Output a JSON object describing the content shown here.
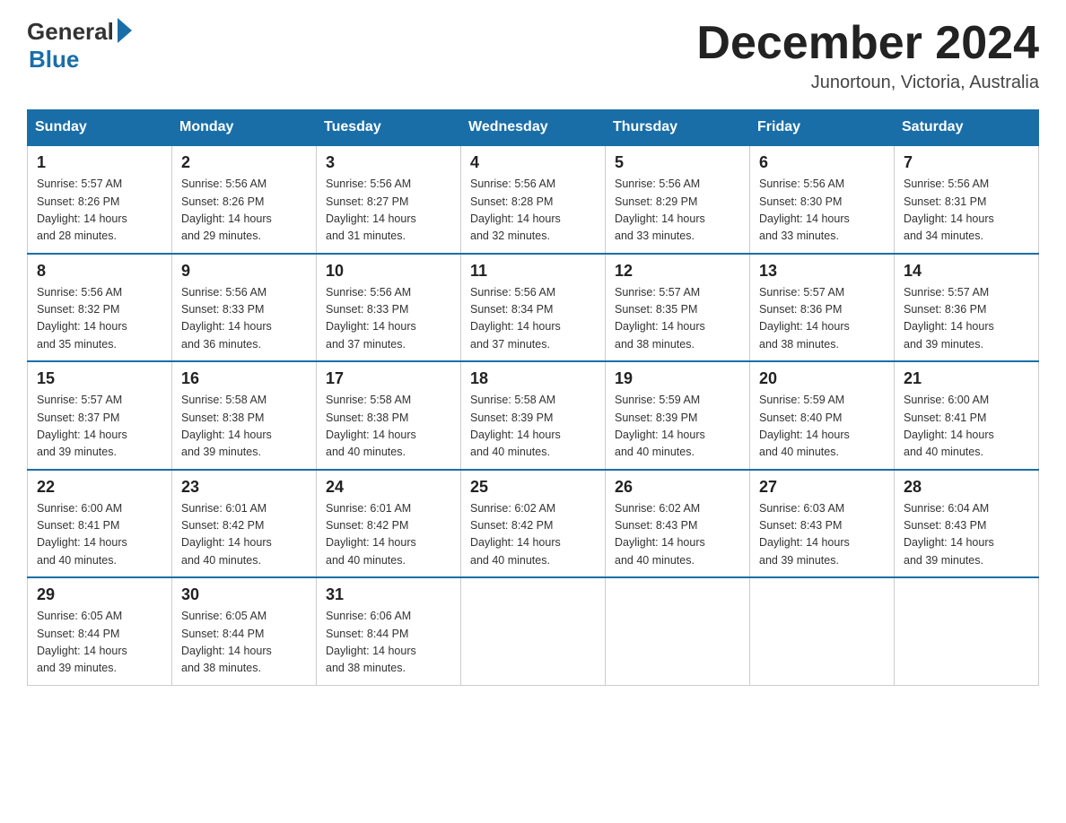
{
  "header": {
    "logo_general": "General",
    "logo_blue": "Blue",
    "month_title": "December 2024",
    "location": "Junortoun, Victoria, Australia"
  },
  "days_of_week": [
    "Sunday",
    "Monday",
    "Tuesday",
    "Wednesday",
    "Thursday",
    "Friday",
    "Saturday"
  ],
  "weeks": [
    [
      {
        "day": "1",
        "sunrise": "5:57 AM",
        "sunset": "8:26 PM",
        "daylight": "14 hours and 28 minutes."
      },
      {
        "day": "2",
        "sunrise": "5:56 AM",
        "sunset": "8:26 PM",
        "daylight": "14 hours and 29 minutes."
      },
      {
        "day": "3",
        "sunrise": "5:56 AM",
        "sunset": "8:27 PM",
        "daylight": "14 hours and 31 minutes."
      },
      {
        "day": "4",
        "sunrise": "5:56 AM",
        "sunset": "8:28 PM",
        "daylight": "14 hours and 32 minutes."
      },
      {
        "day": "5",
        "sunrise": "5:56 AM",
        "sunset": "8:29 PM",
        "daylight": "14 hours and 33 minutes."
      },
      {
        "day": "6",
        "sunrise": "5:56 AM",
        "sunset": "8:30 PM",
        "daylight": "14 hours and 33 minutes."
      },
      {
        "day": "7",
        "sunrise": "5:56 AM",
        "sunset": "8:31 PM",
        "daylight": "14 hours and 34 minutes."
      }
    ],
    [
      {
        "day": "8",
        "sunrise": "5:56 AM",
        "sunset": "8:32 PM",
        "daylight": "14 hours and 35 minutes."
      },
      {
        "day": "9",
        "sunrise": "5:56 AM",
        "sunset": "8:33 PM",
        "daylight": "14 hours and 36 minutes."
      },
      {
        "day": "10",
        "sunrise": "5:56 AM",
        "sunset": "8:33 PM",
        "daylight": "14 hours and 37 minutes."
      },
      {
        "day": "11",
        "sunrise": "5:56 AM",
        "sunset": "8:34 PM",
        "daylight": "14 hours and 37 minutes."
      },
      {
        "day": "12",
        "sunrise": "5:57 AM",
        "sunset": "8:35 PM",
        "daylight": "14 hours and 38 minutes."
      },
      {
        "day": "13",
        "sunrise": "5:57 AM",
        "sunset": "8:36 PM",
        "daylight": "14 hours and 38 minutes."
      },
      {
        "day": "14",
        "sunrise": "5:57 AM",
        "sunset": "8:36 PM",
        "daylight": "14 hours and 39 minutes."
      }
    ],
    [
      {
        "day": "15",
        "sunrise": "5:57 AM",
        "sunset": "8:37 PM",
        "daylight": "14 hours and 39 minutes."
      },
      {
        "day": "16",
        "sunrise": "5:58 AM",
        "sunset": "8:38 PM",
        "daylight": "14 hours and 39 minutes."
      },
      {
        "day": "17",
        "sunrise": "5:58 AM",
        "sunset": "8:38 PM",
        "daylight": "14 hours and 40 minutes."
      },
      {
        "day": "18",
        "sunrise": "5:58 AM",
        "sunset": "8:39 PM",
        "daylight": "14 hours and 40 minutes."
      },
      {
        "day": "19",
        "sunrise": "5:59 AM",
        "sunset": "8:39 PM",
        "daylight": "14 hours and 40 minutes."
      },
      {
        "day": "20",
        "sunrise": "5:59 AM",
        "sunset": "8:40 PM",
        "daylight": "14 hours and 40 minutes."
      },
      {
        "day": "21",
        "sunrise": "6:00 AM",
        "sunset": "8:41 PM",
        "daylight": "14 hours and 40 minutes."
      }
    ],
    [
      {
        "day": "22",
        "sunrise": "6:00 AM",
        "sunset": "8:41 PM",
        "daylight": "14 hours and 40 minutes."
      },
      {
        "day": "23",
        "sunrise": "6:01 AM",
        "sunset": "8:42 PM",
        "daylight": "14 hours and 40 minutes."
      },
      {
        "day": "24",
        "sunrise": "6:01 AM",
        "sunset": "8:42 PM",
        "daylight": "14 hours and 40 minutes."
      },
      {
        "day": "25",
        "sunrise": "6:02 AM",
        "sunset": "8:42 PM",
        "daylight": "14 hours and 40 minutes."
      },
      {
        "day": "26",
        "sunrise": "6:02 AM",
        "sunset": "8:43 PM",
        "daylight": "14 hours and 40 minutes."
      },
      {
        "day": "27",
        "sunrise": "6:03 AM",
        "sunset": "8:43 PM",
        "daylight": "14 hours and 39 minutes."
      },
      {
        "day": "28",
        "sunrise": "6:04 AM",
        "sunset": "8:43 PM",
        "daylight": "14 hours and 39 minutes."
      }
    ],
    [
      {
        "day": "29",
        "sunrise": "6:05 AM",
        "sunset": "8:44 PM",
        "daylight": "14 hours and 39 minutes."
      },
      {
        "day": "30",
        "sunrise": "6:05 AM",
        "sunset": "8:44 PM",
        "daylight": "14 hours and 38 minutes."
      },
      {
        "day": "31",
        "sunrise": "6:06 AM",
        "sunset": "8:44 PM",
        "daylight": "14 hours and 38 minutes."
      },
      null,
      null,
      null,
      null
    ]
  ],
  "labels": {
    "sunrise": "Sunrise:",
    "sunset": "Sunset:",
    "daylight": "Daylight:"
  }
}
